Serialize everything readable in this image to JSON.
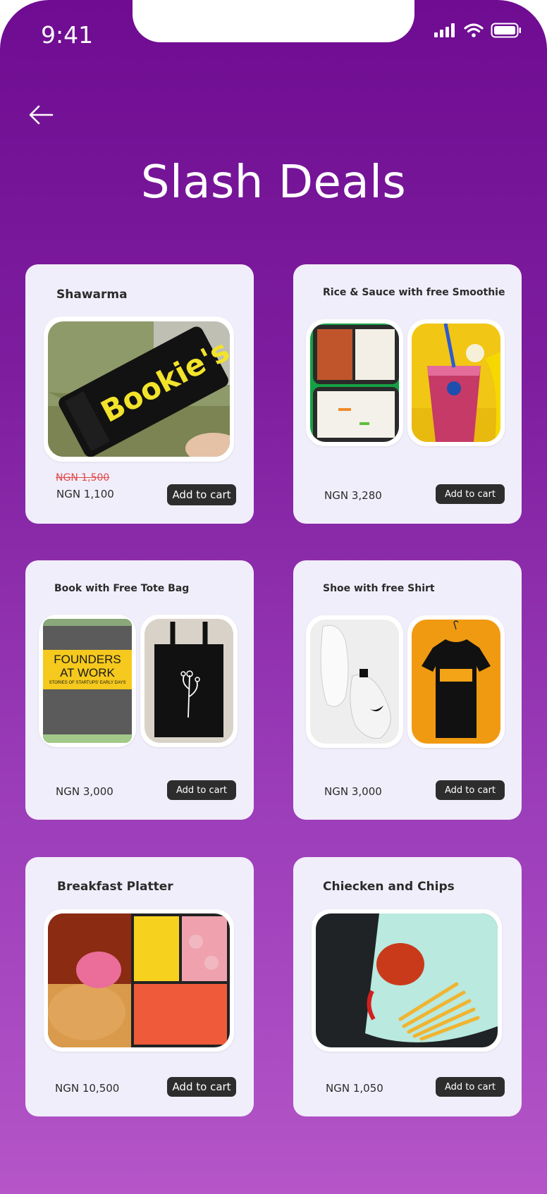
{
  "status_bar": {
    "time": "9:41"
  },
  "header": {
    "title": "Slash Deals"
  },
  "deals": [
    {
      "title": "Shawarma",
      "old_price": "NGN 1,500",
      "price": "NGN 1,100",
      "cart_label": "Add to cart"
    },
    {
      "title": "Rice & Sauce with free Smoothie",
      "price": "NGN 3,280",
      "cart_label": "Add to cart"
    },
    {
      "title": "Book with Free Tote Bag",
      "price": "NGN 3,000",
      "cart_label": "Add to cart",
      "book_title": "FOUNDERS AT WORK",
      "book_subtitle": "STORIES OF STARTUPS' EARLY DAYS"
    },
    {
      "title": "Shoe with free Shirt",
      "price": "NGN 3,000",
      "cart_label": "Add to cart"
    },
    {
      "title": "Breakfast Platter",
      "price": "NGN 10,500",
      "cart_label": "Add to cart"
    },
    {
      "title": "Chiecken and Chips",
      "price": "NGN 1,050",
      "cart_label": "Add to cart"
    }
  ],
  "brand_stamp": "Bookie's",
  "colors": {
    "accent": "#6f0c92",
    "card": "#f1eefb",
    "button": "#2d2d2d",
    "strike": "#e04a4a"
  }
}
